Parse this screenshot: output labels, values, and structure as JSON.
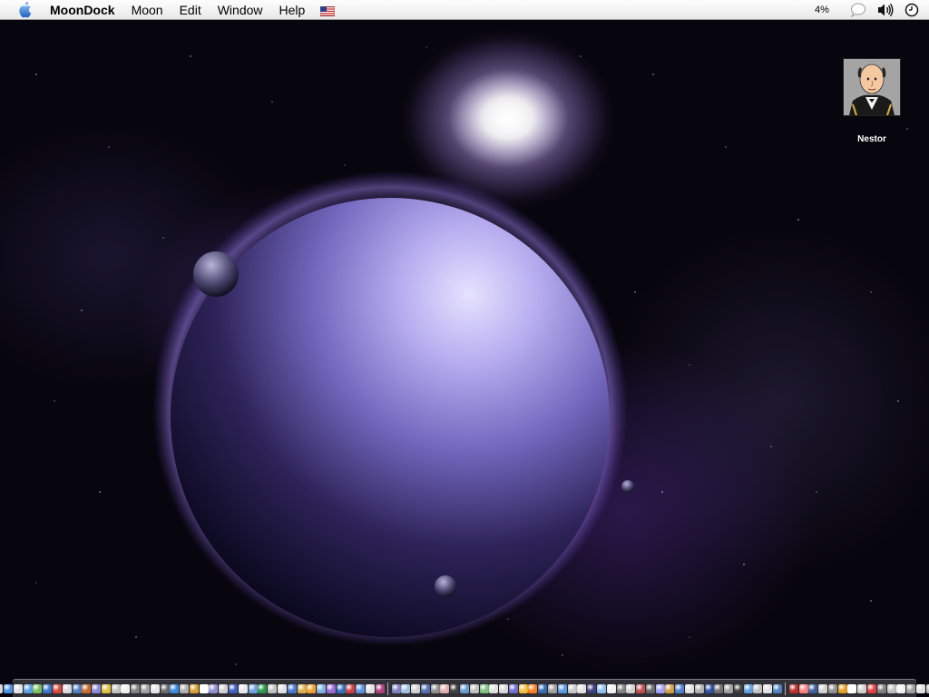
{
  "menubar": {
    "apple_menu_icon": "apple-logo-icon",
    "app_name": "MoonDock",
    "menus": [
      {
        "label": "Moon"
      },
      {
        "label": "Edit"
      },
      {
        "label": "Window"
      },
      {
        "label": "Help"
      }
    ],
    "input_menu_icon": "us-flag-icon",
    "extras": {
      "battery_text": "4%",
      "speech_icon": "speech-bubble-icon",
      "volume_icon": "speaker-volume-icon",
      "clock_icon": "clock-icon"
    }
  },
  "desktop": {
    "wallpaper": "purple planet with moons in space",
    "icons": [
      {
        "label": "Nestor",
        "icon": "nestor-portrait-icon"
      }
    ]
  },
  "dock": {
    "position": "bottom",
    "item_colors": [
      "#5b7fd6",
      "#8fb0e8",
      "#3d6bd1",
      "#c9a45a",
      "#d6d6d6",
      "#4a90e2",
      "#e2e2e2",
      "#5aa0e6",
      "#7bbf5a",
      "#3b76c8",
      "#d94a3a",
      "#d9d9d9",
      "#4f7fbf",
      "#c96a2a",
      "#8a8ad8",
      "#e0c040",
      "#c0c0c0",
      "#f0f0f0",
      "#808080",
      "#a0a0a0",
      "#e6e6e6",
      "#6a6a6a",
      "#3a8ae0",
      "#b0b0b0",
      "#d9a030",
      "#ffffff",
      "#9090d0",
      "#d0d0d0",
      "#4060c0",
      "#e8e8e8",
      "#70a0e0",
      "#2a9a4a",
      "#c0c0c0",
      "#e0e0e0",
      "#4a7ad0",
      "#d8b050",
      "#f0a030",
      "#80b0e0",
      "#9a6ad0",
      "#3070c0",
      "#d04040",
      "#6090e0",
      "#e0e0e0",
      "#b04080",
      "#8080c0",
      "#a0c0e0",
      "#d0d0d0",
      "#5070b0",
      "#909090",
      "#e0b0b0",
      "#404040",
      "#6a9ad0",
      "#c0c0c0",
      "#80c080",
      "#e0e0e0",
      "#d8d8d8",
      "#7070d0",
      "#f0c040",
      "#ff8020",
      "#3a6ab0",
      "#a0a0a0",
      "#5a9ae0",
      "#c8c8c8",
      "#e0e0e0",
      "#404080",
      "#90c0f0",
      "#f0f0f0",
      "#808080",
      "#d0d0d0",
      "#c05050",
      "#6a6a6a",
      "#a0a0ff",
      "#d0a040",
      "#5080d0",
      "#e0e0e0",
      "#b0b0b0",
      "#3050a0",
      "#707070",
      "#a0a0a0",
      "#404040",
      "#60a0e0",
      "#c0c0c0",
      "#e0e0e0",
      "#5080c0",
      "#c03030",
      "#ff8080",
      "#4060a0",
      "#d0d0d0",
      "#909090",
      "#e0a020",
      "#ffffff",
      "#d0d0d0",
      "#e04040",
      "#808080",
      "#c0c0c0",
      "#f0f0f0",
      "#a0a0a0",
      "#e0e0e0",
      "#c0c0c0",
      "#f8f8f8",
      "#d0d0d0",
      "#e0e0e0",
      "#b0b0b0"
    ],
    "separator_after": [
      44,
      84
    ]
  }
}
